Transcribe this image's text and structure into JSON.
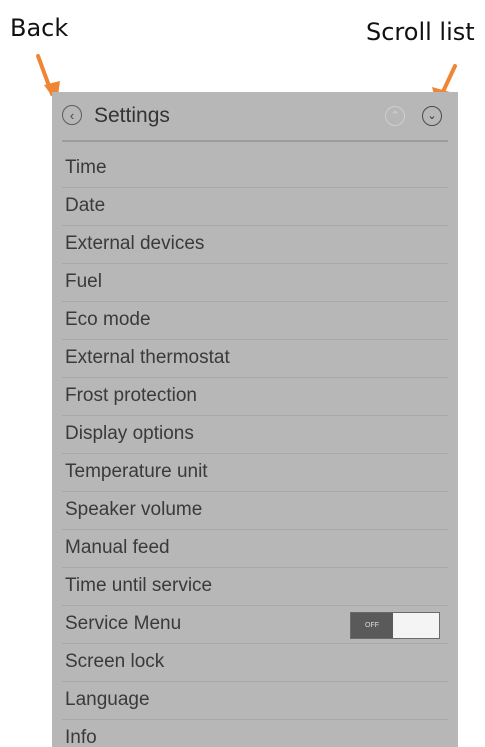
{
  "annotations": {
    "back": "Back",
    "scroll": "Scroll list"
  },
  "header": {
    "title": "Settings",
    "back_icon": "chevron-left-circle-icon",
    "scroll_up_icon": "chevron-up-circle-icon",
    "scroll_down_icon": "chevron-down-circle-icon"
  },
  "colors": {
    "panel_bg": "#b7b7b7",
    "arrow": "#ee8636",
    "text": "#3a3a3a"
  },
  "menu": {
    "items": [
      {
        "label": "Time"
      },
      {
        "label": "Date"
      },
      {
        "label": "External devices"
      },
      {
        "label": "Fuel"
      },
      {
        "label": "Eco mode"
      },
      {
        "label": "External thermostat"
      },
      {
        "label": "Frost protection"
      },
      {
        "label": "Display options"
      },
      {
        "label": "Temperature unit"
      },
      {
        "label": "Speaker volume"
      },
      {
        "label": "Manual feed"
      },
      {
        "label": "Time until service"
      },
      {
        "label": "Service Menu",
        "toggle": "OFF"
      },
      {
        "label": "Screen lock"
      },
      {
        "label": "Language"
      },
      {
        "label": "Info"
      }
    ]
  }
}
